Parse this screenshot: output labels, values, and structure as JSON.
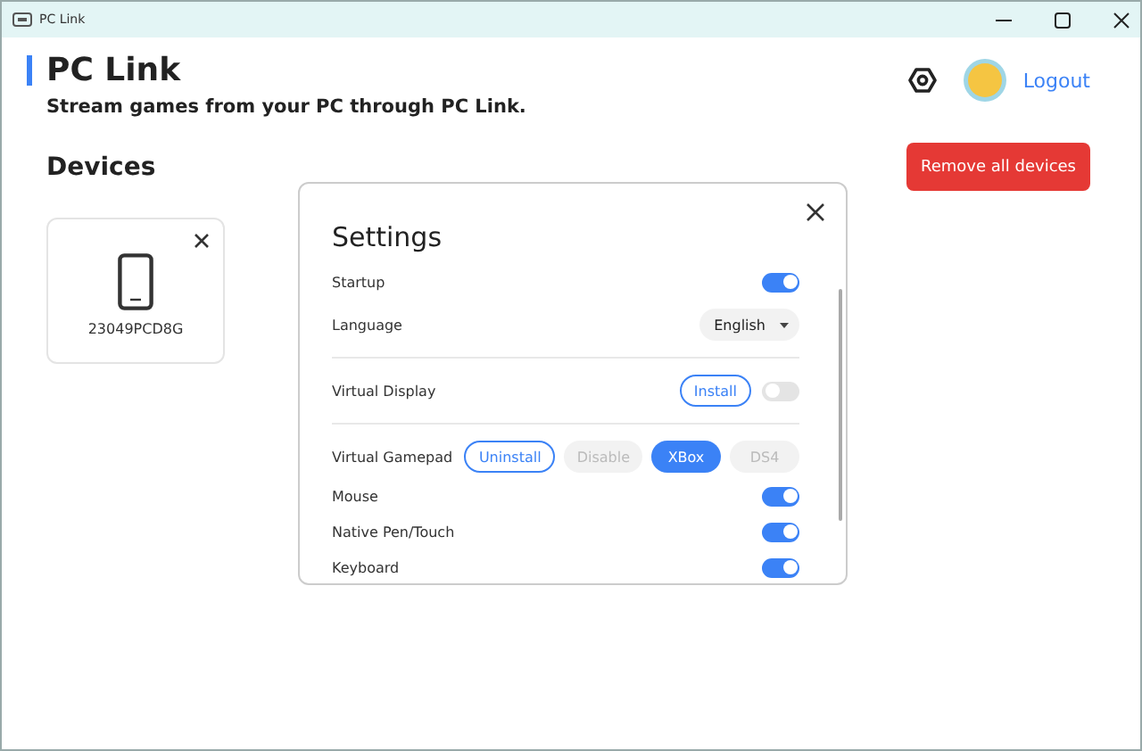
{
  "window": {
    "title": "PC Link"
  },
  "header": {
    "title": "PC Link",
    "subtitle": "Stream games from your PC through PC Link.",
    "logout": "Logout"
  },
  "devices": {
    "heading": "Devices",
    "remove_all": "Remove all devices",
    "items": [
      {
        "name": "23049PCD8G"
      }
    ]
  },
  "settings": {
    "title": "Settings",
    "groups": [
      [
        {
          "kind": "toggle",
          "label": "Startup",
          "on": true
        },
        {
          "kind": "select",
          "label": "Language",
          "value": "English"
        }
      ],
      [
        {
          "kind": "install",
          "label": "Virtual Display",
          "action": "Install",
          "on": false
        }
      ],
      [
        {
          "kind": "gamepad",
          "label": "Virtual Gamepad",
          "action": "Uninstall",
          "options": [
            {
              "label": "Disable",
              "selected": false
            },
            {
              "label": "XBox",
              "selected": true
            },
            {
              "label": "DS4",
              "selected": false
            }
          ]
        },
        {
          "kind": "toggle",
          "label": "Mouse",
          "on": true
        },
        {
          "kind": "toggle",
          "label": "Native Pen/Touch",
          "on": true
        },
        {
          "kind": "toggle",
          "label": "Keyboard",
          "on": true
        }
      ]
    ]
  }
}
